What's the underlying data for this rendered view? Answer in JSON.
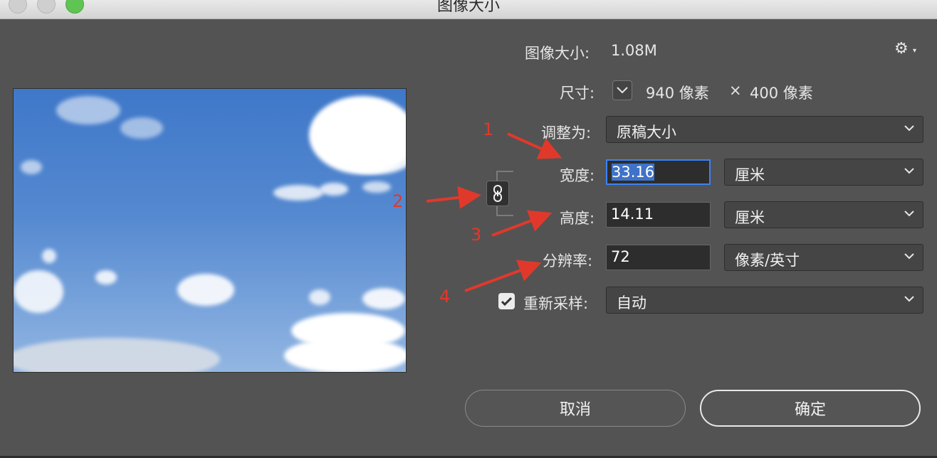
{
  "window": {
    "title": "图像大小"
  },
  "info": {
    "image_size_label": "图像大小:",
    "image_size_value": "1.08M"
  },
  "dimensions": {
    "label": "尺寸:",
    "width_px": "940 像素",
    "times": "×",
    "height_px": "400 像素"
  },
  "fit_to": {
    "label": "调整为:",
    "value": "原稿大小"
  },
  "width": {
    "label": "宽度:",
    "value": "33.16",
    "unit": "厘米"
  },
  "height": {
    "label": "高度:",
    "value": "14.11",
    "unit": "厘米"
  },
  "resolution": {
    "label": "分辨率:",
    "value": "72",
    "unit": "像素/英寸"
  },
  "resample": {
    "label": "重新采样:",
    "checked": true,
    "value": "自动"
  },
  "buttons": {
    "cancel": "取消",
    "ok": "确定"
  },
  "annotations": [
    "1",
    "2",
    "3",
    "4"
  ],
  "colors": {
    "annotation": "#e0392b",
    "panel": "#535353",
    "focus": "#3b82f6"
  },
  "icons": [
    "gear-icon",
    "chevron-down-icon",
    "chain-link-icon",
    "checkmark-icon"
  ]
}
